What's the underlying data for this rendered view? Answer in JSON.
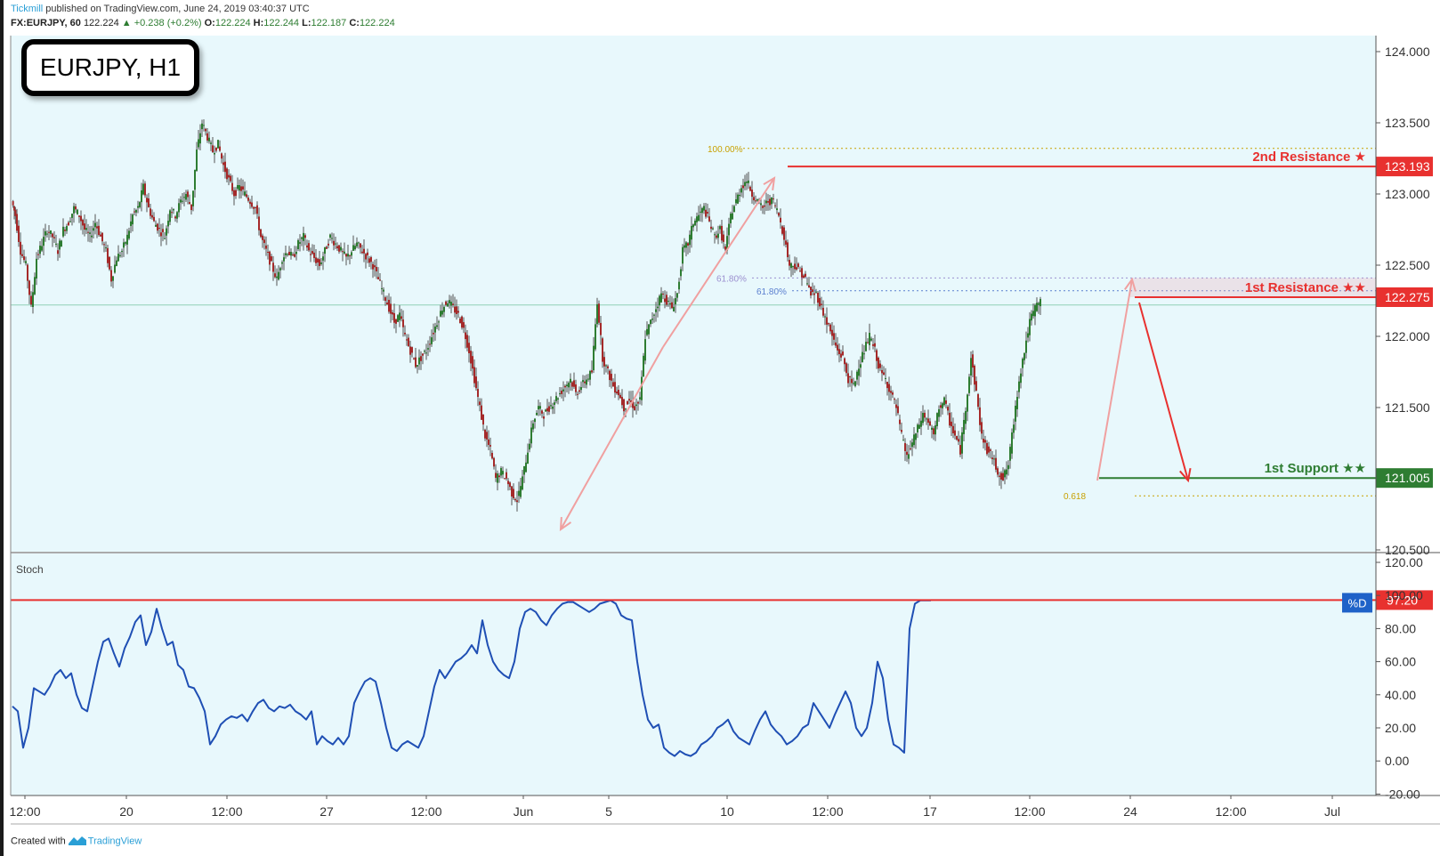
{
  "header": {
    "brand": "Tickmill",
    "published": " published on TradingView.com, June 24, 2019 03:40:37 UTC",
    "symbol": "FX:EURJPY, 60",
    "last": "122.224",
    "change": "▲ +0.238 (+0.2%)",
    "o_label": "O:",
    "o_val": "122.224",
    "h_label": "H:",
    "h_val": "122.244",
    "l_label": "L:",
    "l_val": "122.187",
    "c_label": "C:",
    "c_val": "122.224"
  },
  "badge": {
    "title": "EURJPY, H1"
  },
  "footer": {
    "created": "Created with",
    "brand": "TradingView",
    "logo_icon": "tradingview-logo-icon"
  },
  "colors": {
    "plot_bg": "#e8f8fc",
    "candle_up": "#2e7d32",
    "candle_down": "#a52a2a",
    "resistance": "#e8312f",
    "support": "#2e7d32",
    "stoch_line": "#1f4fb4",
    "arrow_pink": "#f0a0a0",
    "fib_gold": "#c8a000",
    "fib_purple": "#9b8fcf"
  },
  "chart_data": {
    "type": "candlestick",
    "title": "EURJPY, H1",
    "symbol": "FX:EURJPY",
    "interval": "60",
    "x_tick_labels": [
      "12:00",
      "20",
      "12:00",
      "27",
      "12:00",
      "Jun",
      "5",
      "10",
      "12:00",
      "17",
      "12:00",
      "24",
      "12:00",
      "Jul"
    ],
    "ylim": [
      120.5,
      124.0
    ],
    "y_tick_labels": [
      "124.000",
      "123.500",
      "123.000",
      "122.500",
      "122.000",
      "121.500",
      "120.500"
    ],
    "price_path_approx": {
      "x": [
        0,
        4,
        10,
        16,
        22,
        28,
        34,
        40,
        46,
        52,
        58,
        64,
        70,
        76,
        82,
        88,
        94,
        100,
        106,
        112,
        118,
        124,
        130,
        136,
        142,
        148,
        154,
        160,
        166,
        172,
        178,
        184,
        190,
        196,
        202,
        208,
        214,
        220,
        226,
        232,
        238,
        244,
        250,
        256,
        262,
        268,
        274,
        280,
        286,
        292,
        298,
        304,
        310,
        316,
        322,
        328,
        334,
        340,
        346,
        352,
        358,
        364,
        370,
        376,
        382,
        388,
        394,
        400,
        406,
        412,
        418,
        424,
        430,
        436,
        442,
        448,
        454,
        460,
        466,
        472,
        478,
        484,
        490,
        496,
        502,
        508,
        514,
        520,
        526,
        532,
        538,
        544,
        550,
        556,
        562,
        568,
        574,
        580,
        586,
        592,
        598,
        604,
        610,
        616,
        622,
        628,
        634,
        640,
        646,
        652,
        658,
        664,
        670,
        676,
        682,
        688,
        694,
        700,
        706,
        712,
        718,
        724,
        730,
        736,
        742,
        748,
        754,
        760,
        766,
        772,
        778,
        784,
        790,
        796,
        802,
        808,
        814,
        820,
        826,
        832,
        838,
        844,
        850,
        856,
        862,
        868,
        874,
        880,
        886,
        892,
        898,
        904,
        910,
        916,
        922,
        928,
        934,
        940,
        946,
        952,
        958,
        964,
        970,
        976,
        982,
        988,
        994,
        1000,
        1006,
        1012,
        1018,
        1024,
        1030,
        1036,
        1042,
        1048,
        1054,
        1060,
        1066,
        1072,
        1078,
        1084,
        1090,
        1096,
        1102,
        1108,
        1114,
        1120,
        1126,
        1132,
        1138,
        1144,
        1150,
        1156,
        1162,
        1168,
        1174,
        1180,
        1186,
        1192,
        1198,
        1204,
        1210,
        1216,
        1222,
        1228,
        1234
      ],
      "y": [
        122.95,
        122.85,
        122.6,
        122.5,
        122.2,
        122.55,
        122.65,
        122.75,
        122.7,
        122.6,
        122.75,
        122.8,
        122.9,
        122.85,
        122.75,
        122.7,
        122.8,
        122.7,
        122.6,
        122.4,
        122.55,
        122.6,
        122.7,
        122.85,
        122.9,
        123.05,
        122.9,
        122.8,
        122.75,
        122.7,
        122.9,
        122.85,
        122.95,
        123.0,
        122.9,
        123.3,
        123.5,
        123.4,
        123.3,
        123.35,
        123.2,
        123.1,
        123.0,
        123.05,
        123.0,
        122.95,
        122.9,
        122.7,
        122.6,
        122.5,
        122.4,
        122.55,
        122.6,
        122.55,
        122.65,
        122.7,
        122.6,
        122.55,
        122.5,
        122.6,
        122.7,
        122.65,
        122.6,
        122.55,
        122.6,
        122.65,
        122.6,
        122.55,
        122.5,
        122.4,
        122.3,
        122.2,
        122.1,
        122.15,
        122.0,
        121.9,
        121.8,
        121.85,
        121.9,
        122.0,
        122.1,
        122.2,
        122.25,
        122.2,
        122.15,
        122.05,
        121.9,
        121.7,
        121.5,
        121.3,
        121.2,
        121.0,
        121.05,
        121.0,
        120.9,
        120.85,
        121.0,
        121.2,
        121.4,
        121.5,
        121.45,
        121.5,
        121.55,
        121.6,
        121.65,
        121.7,
        121.6,
        121.65,
        121.7,
        121.75,
        122.25,
        121.85,
        121.75,
        121.65,
        121.6,
        121.5,
        121.55,
        121.5,
        121.55,
        122.0,
        122.1,
        122.2,
        122.3,
        122.25,
        122.2,
        122.3,
        122.6,
        122.65,
        122.8,
        122.85,
        122.9,
        122.8,
        122.7,
        122.75,
        122.6,
        122.85,
        122.95,
        123.05,
        123.1,
        123.0,
        122.95,
        122.9,
        122.95,
        122.95,
        122.85,
        122.7,
        122.5,
        122.5,
        122.45,
        122.4,
        122.3,
        122.3,
        122.2,
        122.1,
        122.0,
        121.9,
        121.85,
        121.7,
        121.65,
        121.8,
        121.9,
        122.0,
        121.9,
        121.75,
        121.7,
        121.6,
        121.5,
        121.3,
        121.15,
        121.25,
        121.35,
        121.45,
        121.4,
        121.3,
        121.5,
        121.55,
        121.4,
        121.3,
        121.2,
        121.5,
        121.85,
        121.6,
        121.3,
        121.2,
        121.15,
        121.05,
        121.0,
        121.1,
        121.4,
        121.7,
        121.9,
        122.1,
        122.2,
        122.25
      ]
    },
    "annotations": [
      {
        "label": "2nd Resistance ★",
        "value": "123.193"
      },
      {
        "label": "1st Resistance ★★",
        "value": "122.275"
      },
      {
        "label": "1st Support ★★",
        "value": "121.005"
      }
    ],
    "fibonacci": [
      {
        "label": "100.00%",
        "value": 123.32
      },
      {
        "label": "61.80%",
        "value": 122.41
      },
      {
        "label": "61.80%",
        "value": 122.32
      },
      {
        "label": "0.618",
        "value": 120.88
      }
    ],
    "last_price_line": 122.22,
    "stochastic": {
      "name": "Stoch",
      "ylim": [
        -20,
        120
      ],
      "y_tick_labels": [
        "120.00",
        "100.00",
        "80.00",
        "60.00",
        "40.00",
        "20.00",
        "0.00",
        "-20.00"
      ],
      "level_line": 97.2,
      "level_label": "97.20",
      "series_label": "%D",
      "x": [
        0,
        6,
        12,
        18,
        24,
        30,
        36,
        42,
        48,
        54,
        60,
        66,
        72,
        78,
        84,
        90,
        96,
        102,
        108,
        114,
        120,
        126,
        132,
        138,
        144,
        150,
        156,
        162,
        168,
        174,
        180,
        186,
        192,
        198,
        204,
        210,
        216,
        222,
        228,
        234,
        240,
        246,
        252,
        258,
        264,
        270,
        276,
        282,
        288,
        294,
        300,
        306,
        312,
        318,
        324,
        330,
        336,
        342,
        348,
        354,
        360,
        366,
        372,
        378,
        384,
        390,
        396,
        402,
        408,
        414,
        420,
        426,
        432,
        438,
        444,
        450,
        456,
        462,
        468,
        474,
        480,
        486,
        492,
        498,
        504,
        510,
        516,
        522,
        528,
        534,
        540,
        546,
        552,
        558,
        564,
        570,
        576,
        582,
        588,
        594,
        600,
        606,
        612,
        618,
        624,
        630,
        636,
        642,
        648,
        654,
        660,
        666,
        672,
        678,
        684,
        690,
        696,
        702,
        708,
        714,
        720,
        726,
        732,
        738,
        744,
        750,
        756,
        762,
        768,
        774,
        780,
        786,
        792,
        798,
        804,
        810,
        816,
        822,
        828,
        834,
        840,
        846,
        852,
        858,
        864,
        870,
        876,
        882,
        888,
        894,
        900,
        906,
        912,
        918,
        924,
        930,
        936,
        942,
        948,
        954,
        960,
        966,
        972,
        978,
        984,
        990,
        996,
        1002,
        1008,
        1014,
        1020,
        1026,
        1032,
        1038,
        1044,
        1050,
        1056,
        1062,
        1068,
        1074,
        1080,
        1086,
        1092,
        1098,
        1104,
        1110,
        1116,
        1122,
        1128,
        1134,
        1140,
        1146,
        1152,
        1158,
        1164,
        1170,
        1176,
        1182,
        1188,
        1194,
        1200,
        1206,
        1212,
        1218,
        1224,
        1230
      ],
      "y": [
        33,
        30,
        8,
        20,
        44,
        42,
        40,
        45,
        52,
        55,
        50,
        53,
        40,
        32,
        30,
        45,
        60,
        72,
        74,
        65,
        57,
        68,
        75,
        84,
        88,
        70,
        78,
        92,
        80,
        70,
        72,
        58,
        55,
        45,
        44,
        38,
        30,
        10,
        15,
        22,
        25,
        27,
        26,
        28,
        24,
        30,
        35,
        37,
        32,
        30,
        33,
        32,
        34,
        30,
        28,
        25,
        30,
        10,
        15,
        12,
        10,
        14,
        10,
        15,
        35,
        42,
        48,
        50,
        48,
        35,
        20,
        8,
        6,
        10,
        12,
        10,
        8,
        15,
        30,
        45,
        55,
        50,
        55,
        60,
        62,
        65,
        70,
        65,
        85,
        70,
        60,
        55,
        52,
        50,
        60,
        80,
        90,
        92,
        90,
        85,
        82,
        88,
        92,
        95,
        96,
        96,
        94,
        92,
        90,
        92,
        95,
        96,
        97,
        95,
        88,
        86,
        85,
        60,
        40,
        25,
        20,
        22,
        8,
        5,
        3,
        6,
        4,
        3,
        5,
        10,
        12,
        15,
        20,
        22,
        25,
        18,
        14,
        12,
        10,
        18,
        25,
        30,
        22,
        18,
        15,
        10,
        12,
        15,
        20,
        22,
        35,
        30,
        25,
        20,
        28,
        35,
        42,
        35,
        20,
        15,
        20,
        35,
        60,
        50,
        25,
        10,
        8,
        5,
        80,
        95,
        97,
        97,
        97
      ]
    }
  }
}
